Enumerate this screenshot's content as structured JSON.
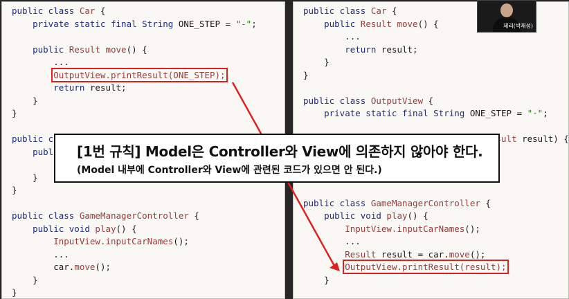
{
  "left_code": [
    [
      {
        "t": "public class ",
        "c": "kw"
      },
      {
        "t": "Car",
        "c": "nm"
      },
      {
        "t": " {",
        "c": ""
      }
    ],
    [
      {
        "t": "    private static final ",
        "c": "kw"
      },
      {
        "t": "String",
        "c": "tp"
      },
      {
        "t": " ONE_STEP = ",
        "c": ""
      },
      {
        "t": "\"-\"",
        "c": "st"
      },
      {
        "t": ";",
        "c": ""
      }
    ],
    [],
    [
      {
        "t": "    public ",
        "c": "kw"
      },
      {
        "t": "Result",
        "c": "nm"
      },
      {
        "t": " ",
        "c": ""
      },
      {
        "t": "move",
        "c": "nm"
      },
      {
        "t": "() {",
        "c": ""
      }
    ],
    [
      {
        "t": "        ...",
        "c": ""
      }
    ],
    [
      {
        "t": "        ",
        "c": ""
      },
      {
        "t": "OutputView.printResult(ONE_STEP);",
        "c": "hl",
        "box": true
      }
    ],
    [
      {
        "t": "        return ",
        "c": "kw"
      },
      {
        "t": "result;",
        "c": ""
      }
    ],
    [
      {
        "t": "    }",
        "c": ""
      }
    ],
    [
      {
        "t": "}",
        "c": ""
      }
    ],
    [],
    [
      {
        "t": "public class ",
        "c": "kw"
      },
      {
        "t": "OutputView",
        "c": "nm"
      },
      {
        "t": " {",
        "c": ""
      }
    ],
    [
      {
        "t": "    public static void ",
        "c": "kw"
      },
      {
        "t": "printResult",
        "c": "nm"
      },
      {
        "t": "() {",
        "c": ""
      }
    ],
    [],
    [
      {
        "t": "    }",
        "c": ""
      }
    ],
    [
      {
        "t": "}",
        "c": ""
      }
    ],
    [],
    [
      {
        "t": "public class ",
        "c": "kw"
      },
      {
        "t": "GameManagerController",
        "c": "nm"
      },
      {
        "t": " {",
        "c": ""
      }
    ],
    [
      {
        "t": "    public void ",
        "c": "kw"
      },
      {
        "t": "play",
        "c": "nm"
      },
      {
        "t": "() {",
        "c": ""
      }
    ],
    [
      {
        "t": "        InputView.inputCarNames",
        "c": "nm"
      },
      {
        "t": "();",
        "c": ""
      }
    ],
    [
      {
        "t": "        ...",
        "c": ""
      }
    ],
    [
      {
        "t": "        car.",
        "c": ""
      },
      {
        "t": "move",
        "c": "nm"
      },
      {
        "t": "();",
        "c": ""
      }
    ],
    [
      {
        "t": "    }",
        "c": ""
      }
    ],
    [
      {
        "t": "}",
        "c": ""
      }
    ]
  ],
  "right_code": [
    [
      {
        "t": "public class ",
        "c": "kw"
      },
      {
        "t": "Car",
        "c": "nm"
      },
      {
        "t": " {",
        "c": ""
      }
    ],
    [
      {
        "t": "    public ",
        "c": "kw"
      },
      {
        "t": "Result",
        "c": "nm"
      },
      {
        "t": " ",
        "c": ""
      },
      {
        "t": "move",
        "c": "nm"
      },
      {
        "t": "() {",
        "c": ""
      }
    ],
    [
      {
        "t": "        ...",
        "c": ""
      }
    ],
    [
      {
        "t": "        return ",
        "c": "kw"
      },
      {
        "t": "result;",
        "c": ""
      }
    ],
    [
      {
        "t": "    }",
        "c": ""
      }
    ],
    [
      {
        "t": "}",
        "c": ""
      }
    ],
    [],
    [
      {
        "t": "public class ",
        "c": "kw"
      },
      {
        "t": "OutputView",
        "c": "nm"
      },
      {
        "t": " {",
        "c": ""
      }
    ],
    [
      {
        "t": "    private static final ",
        "c": "kw"
      },
      {
        "t": "String",
        "c": "tp"
      },
      {
        "t": " ONE_STEP = ",
        "c": ""
      },
      {
        "t": "\"-\"",
        "c": "st"
      },
      {
        "t": ";",
        "c": ""
      }
    ],
    [],
    [
      {
        "t": "    public static void ",
        "c": "kw"
      },
      {
        "t": "printResult",
        "c": "nm"
      },
      {
        "t": "(",
        "c": ""
      },
      {
        "t": "Result",
        "c": "nm"
      },
      {
        "t": " result) {",
        "c": ""
      }
    ],
    [],
    [
      {
        "t": "    }",
        "c": ""
      }
    ],
    [
      {
        "t": "}",
        "c": ""
      }
    ],
    [],
    [
      {
        "t": "public class ",
        "c": "kw"
      },
      {
        "t": "GameManagerController",
        "c": "nm"
      },
      {
        "t": " {",
        "c": ""
      }
    ],
    [
      {
        "t": "    public void ",
        "c": "kw"
      },
      {
        "t": "play",
        "c": "nm"
      },
      {
        "t": "() {",
        "c": ""
      }
    ],
    [
      {
        "t": "        InputView.inputCarNames",
        "c": "nm"
      },
      {
        "t": "();",
        "c": ""
      }
    ],
    [
      {
        "t": "        ...",
        "c": ""
      }
    ],
    [
      {
        "t": "        ",
        "c": ""
      },
      {
        "t": "Result",
        "c": "nm"
      },
      {
        "t": " result = car.",
        "c": ""
      },
      {
        "t": "move",
        "c": "nm"
      },
      {
        "t": "();",
        "c": ""
      }
    ],
    [
      {
        "t": "        ",
        "c": ""
      },
      {
        "t": "OutputView.printResult(result);",
        "c": "hl",
        "box": true
      }
    ],
    [
      {
        "t": "    }",
        "c": ""
      }
    ]
  ],
  "annotation": {
    "title": "[1번 규칙] Model은 Controller와 View에 의존하지 않아야 한다.",
    "subtitle": "(Model 내부에 Controller와 View에 관련된 코드가 있으면 안 된다.)"
  },
  "webcam": {
    "label": "제리(박재성)"
  },
  "colors": {
    "keyword": "#1f2a80",
    "name": "#9a3b3b",
    "string": "#2f7a1f",
    "highlight_box": "#e0201c",
    "arrow": "#e0201c"
  }
}
